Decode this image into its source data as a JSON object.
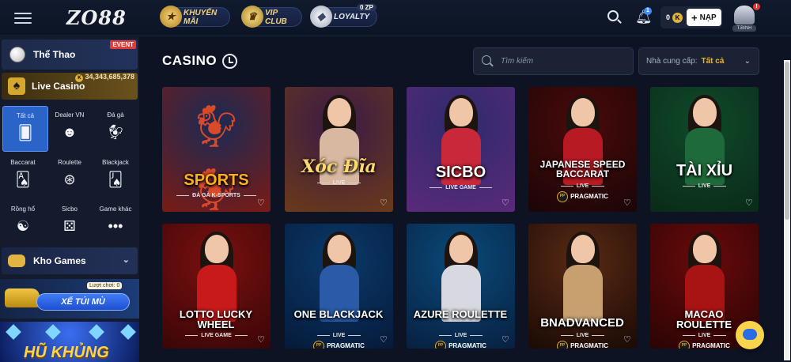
{
  "header": {
    "logo": "ZO88",
    "promos": [
      {
        "label": "KHUYẾN MÃI",
        "icon": "gift-icon"
      },
      {
        "label": "VIP CLUB",
        "icon": "crown-icon"
      },
      {
        "label": "LOYALTY",
        "icon": "diamond-icon",
        "badge": "0 ZP"
      }
    ],
    "bell_count": "1",
    "balance": "0",
    "coin_symbol": "K",
    "deposit_label": "NẠP",
    "avatar_label": "T.BINH",
    "avatar_alert": "!"
  },
  "sidebar": {
    "sports_label": "Thể Thao",
    "event_tag": "EVENT",
    "live_label": "Live Casino",
    "live_amount": "34,343,685,378",
    "sub_items": [
      {
        "label": "Tất cả",
        "icon": "cards-icon"
      },
      {
        "label": "Dealer VN",
        "icon": "dealer-icon"
      },
      {
        "label": "Đá gà",
        "icon": "rooster-icon"
      },
      {
        "label": "Baccarat",
        "icon": "baccarat-icon"
      },
      {
        "label": "Roulette",
        "icon": "roulette-icon"
      },
      {
        "label": "Blackjack",
        "icon": "blackjack-icon"
      },
      {
        "label": "Rồng hổ",
        "icon": "dragon-tiger-icon"
      },
      {
        "label": "Sicbo",
        "icon": "dice-icon"
      },
      {
        "label": "Game khác",
        "icon": "more-icon"
      }
    ],
    "kho_label": "Kho Games",
    "banner_xe_label": "XẾ TÚI MÙ",
    "banner_xe_tag": "Lượt chơi: 0",
    "banner_hu_label": "HŨ KHỦNG"
  },
  "main": {
    "title": "CASINO",
    "search_placeholder": "Tìm kiếm",
    "provider_label": "Nhà cung cấp:",
    "provider_value": "Tất cả"
  },
  "games": [
    {
      "title": "SPORTS",
      "subtitle": "ĐÁ GÀ K-SPORTS",
      "provider": "",
      "colors": [
        "#1a2a55",
        "#7a1b14"
      ],
      "figure": "rooster"
    },
    {
      "title": "Xóc Đĩa",
      "subtitle": "LIVE",
      "provider": "",
      "colors": [
        "#3a1a45",
        "#6a3a1a"
      ],
      "figure": "woman",
      "outfit": "#d8b8a0"
    },
    {
      "title": "SICBO",
      "subtitle": "LIVE GAME",
      "provider": "",
      "colors": [
        "#2e2a6a",
        "#5a2a7a"
      ],
      "figure": "woman",
      "outfit": "#c8283a"
    },
    {
      "title": "JAPANESE SPEED BACCARAT",
      "subtitle": "LIVE",
      "provider": "PRAGMATIC",
      "colors": [
        "#4a0a0a",
        "#1a0608"
      ],
      "figure": "woman",
      "outfit": "#b81a24"
    },
    {
      "title": "TÀI XỈU",
      "subtitle": "LIVE",
      "provider": "",
      "colors": [
        "#0f4a2a",
        "#0a2a18"
      ],
      "figure": "woman",
      "outfit": "#1f6a3a"
    },
    {
      "title": "LOTTO LUCKY WHEEL",
      "subtitle": "LIVE GAME",
      "provider": "",
      "colors": [
        "#7a1010",
        "#3a0606"
      ],
      "figure": "woman",
      "outfit": "#c81a1a"
    },
    {
      "title": "ONE BLACKJACK",
      "subtitle": "LIVE",
      "provider": "PRAGMATIC",
      "colors": [
        "#0a3a6a",
        "#061a3a"
      ],
      "figure": "woman",
      "outfit": "#2a5aa8"
    },
    {
      "title": "AZURE ROULETTE",
      "subtitle": "LIVE",
      "provider": "PRAGMATIC",
      "colors": [
        "#0a4a7a",
        "#082040"
      ],
      "figure": "woman",
      "outfit": "#d8d8e0"
    },
    {
      "title": "BNADVANCED",
      "subtitle": "LIVE",
      "provider": "PRAGMATIC",
      "colors": [
        "#5a2a14",
        "#1a0a06"
      ],
      "figure": "woman",
      "outfit": "#c8a070"
    },
    {
      "title": "MACAO ROULETTE",
      "subtitle": "LIVE",
      "provider": "PRAGMATIC",
      "colors": [
        "#6a0a0a",
        "#2a0404"
      ],
      "figure": "woman",
      "outfit": "#a81414"
    }
  ]
}
